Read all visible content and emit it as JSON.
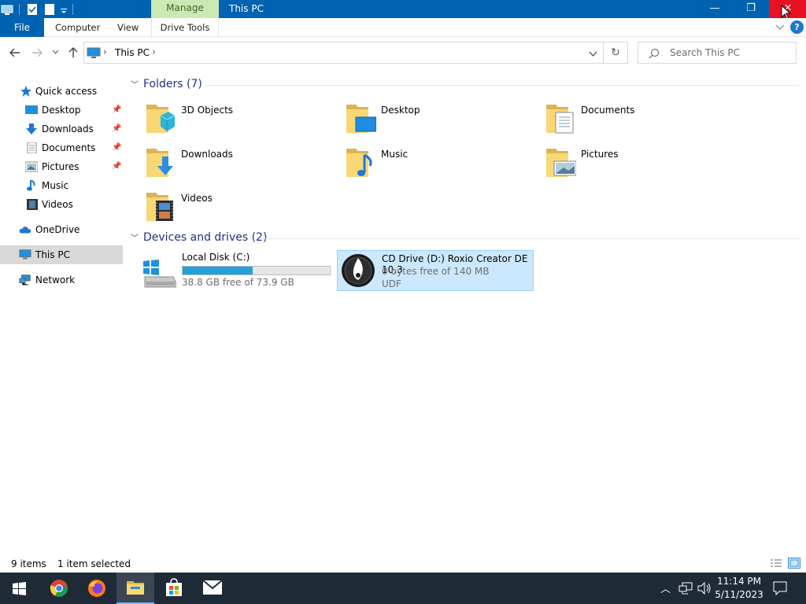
{
  "titlebar": {
    "manage_tab": "Manage",
    "title": "This PC",
    "minimize": "—",
    "restore": "❐",
    "close": "✕"
  },
  "ribbon": {
    "file": "File",
    "tabs": [
      "Computer",
      "View",
      "Drive Tools"
    ],
    "expand_icon": "chevron-down-icon",
    "help": "?"
  },
  "address": {
    "path": [
      "This PC"
    ],
    "search_placeholder": "Search This PC"
  },
  "sidebar": {
    "quick_access": "Quick access",
    "quick_items": [
      {
        "label": "Desktop",
        "pinned": true
      },
      {
        "label": "Downloads",
        "pinned": true
      },
      {
        "label": "Documents",
        "pinned": true
      },
      {
        "label": "Pictures",
        "pinned": true
      },
      {
        "label": "Music",
        "pinned": false
      },
      {
        "label": "Videos",
        "pinned": false
      }
    ],
    "onedrive": "OneDrive",
    "this_pc": "This PC",
    "network": "Network"
  },
  "folders": {
    "header": "Folders (7)",
    "items": [
      "3D Objects",
      "Desktop",
      "Documents",
      "Downloads",
      "Music",
      "Pictures",
      "Videos"
    ]
  },
  "drives": {
    "header": "Devices and drives (2)",
    "items": [
      {
        "name": "Local Disk (C:)",
        "free_text": "38.8 GB free of 73.9 GB",
        "used_fraction": 0.475
      },
      {
        "name": "CD Drive (D:) Roxio Creator DE 10.3",
        "free_text": "0 bytes free of 140 MB",
        "fs": "UDF"
      }
    ]
  },
  "status": {
    "items": "9 items",
    "selected": "1 item selected"
  },
  "taskbar": {
    "time": "11:14 PM",
    "date": "5/11/2023"
  },
  "colors": {
    "titlebar": "#0063b1",
    "close": "#e81123",
    "selection": "#cce8ff",
    "taskbar": "#1f2a37",
    "drive_bar": "#26a0da"
  }
}
